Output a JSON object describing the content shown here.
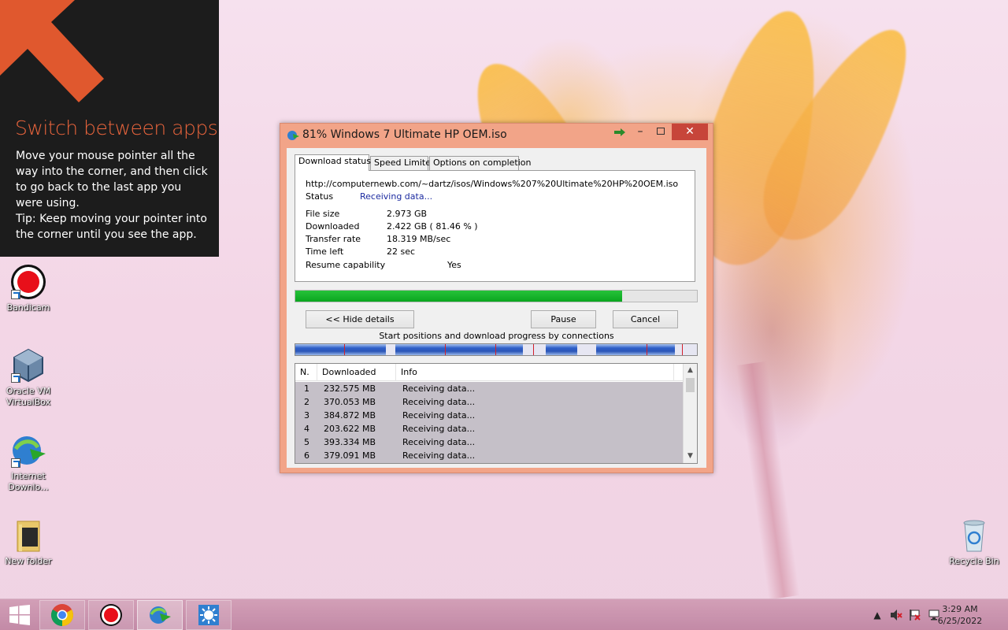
{
  "tip": {
    "title": "Switch between apps",
    "body": "Move your mouse pointer all the way into the corner, and then click to go back to the last app you were using.",
    "tip": "Tip: Keep moving your pointer into the corner until you see the app."
  },
  "desktop_icons": [
    {
      "label": "Bandicam",
      "icon": "bandicam-icon"
    },
    {
      "label": "Oracle VM VirtualBox",
      "icon": "virtualbox-icon"
    },
    {
      "label": "Internet Downlo...",
      "icon": "idm-icon"
    },
    {
      "label": "New folder",
      "icon": "folder-icon"
    },
    {
      "label": "Recycle Bin",
      "icon": "recycle-bin-icon"
    }
  ],
  "window": {
    "title": "81% Windows 7 Ultimate HP OEM.iso",
    "tabs": [
      "Download status",
      "Speed Limiter",
      "Options on completion"
    ],
    "url": "http://computernewb.com/~dartz/isos/Windows%207%20Ultimate%20HP%20OEM.iso",
    "status_label": "Status",
    "status_value": "Receiving data...",
    "fields": [
      {
        "label": "File size",
        "value": "2.973  GB"
      },
      {
        "label": "Downloaded",
        "value": "2.422  GB  ( 81.46 % )"
      },
      {
        "label": "Transfer rate",
        "value": "18.319  MB/sec"
      },
      {
        "label": "Time left",
        "value": "22 sec"
      }
    ],
    "resume_label": "Resume capability",
    "resume_value": "Yes",
    "progress_percent": 81.46,
    "buttons": {
      "hide": "<< Hide details",
      "pause": "Pause",
      "cancel": "Cancel"
    },
    "connections_caption": "Start positions and download progress by connections",
    "connections": {
      "columns": [
        "N.",
        "Downloaded",
        "Info"
      ],
      "rows": [
        {
          "n": "1",
          "downloaded": "232.575  MB",
          "info": "Receiving data..."
        },
        {
          "n": "2",
          "downloaded": "370.053  MB",
          "info": "Receiving data..."
        },
        {
          "n": "3",
          "downloaded": "384.872  MB",
          "info": "Receiving data..."
        },
        {
          "n": "4",
          "downloaded": "203.622  MB",
          "info": "Receiving data..."
        },
        {
          "n": "5",
          "downloaded": "393.334  MB",
          "info": "Receiving data..."
        },
        {
          "n": "6",
          "downloaded": "379.091  MB",
          "info": "Receiving data..."
        }
      ]
    }
  },
  "taskbar": {
    "apps": [
      "start-icon",
      "chrome-icon",
      "bandicam-icon",
      "idm-icon",
      "control-panel-icon"
    ],
    "time": "3:29 AM",
    "date": "6/25/2022"
  },
  "colors": {
    "accent": "#e8643c",
    "progress": "#0aa61f",
    "window_frame": "#f2a488",
    "close": "#c7453a"
  }
}
